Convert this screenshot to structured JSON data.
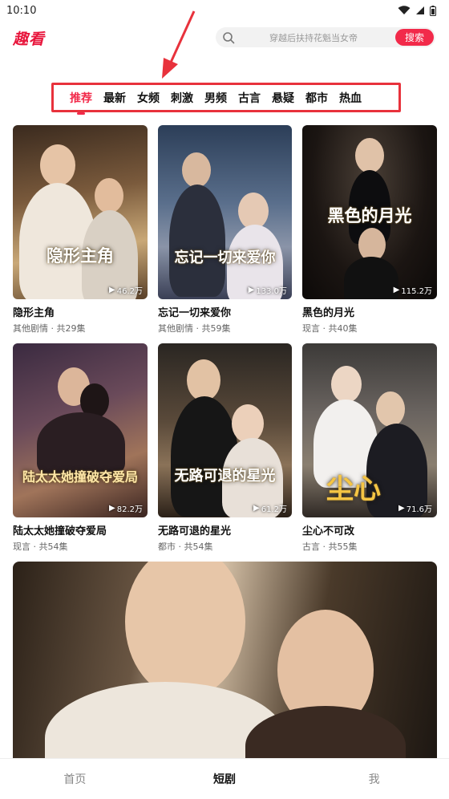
{
  "status_bar": {
    "time": "10:10"
  },
  "header": {
    "logo": "趣看",
    "search_placeholder": "穿越后扶持花魁当女帝",
    "search_button": "搜索"
  },
  "tabs": [
    {
      "label": "推荐",
      "active": true
    },
    {
      "label": "最新"
    },
    {
      "label": "女频"
    },
    {
      "label": "刺激"
    },
    {
      "label": "男频"
    },
    {
      "label": "古言"
    },
    {
      "label": "悬疑"
    },
    {
      "label": "都市"
    },
    {
      "label": "热血"
    }
  ],
  "dramas": [
    {
      "title": "隐形主角",
      "poster_text": "隐形主角",
      "meta": "其他剧情 · 共29集",
      "views": "46.2万"
    },
    {
      "title": "忘记一切来爱你",
      "poster_text": "忘记一切来爱你",
      "meta": "其他剧情 · 共59集",
      "views": "133.0万"
    },
    {
      "title": "黑色的月光",
      "poster_text": "黑色的月光",
      "meta": "现言 · 共40集",
      "views": "115.2万"
    },
    {
      "title": "陆太太她撞破夺爱局",
      "poster_text": "陆太太她撞破夺爱局",
      "meta": "现言 · 共54集",
      "views": "82.2万"
    },
    {
      "title": "无路可退的星光",
      "poster_text": "无路可退的星光",
      "meta": "都市 · 共54集",
      "views": "61.2万"
    },
    {
      "title": "尘心不可改",
      "poster_text": "尘心",
      "meta": "古言 · 共55集",
      "views": "71.6万"
    }
  ],
  "bottom_nav": [
    {
      "label": "首页"
    },
    {
      "label": "短剧",
      "active": true
    },
    {
      "label": "我"
    }
  ],
  "colors": {
    "accent": "#f22a4a",
    "logo": "#e8163c",
    "annotation": "#e8323c"
  }
}
